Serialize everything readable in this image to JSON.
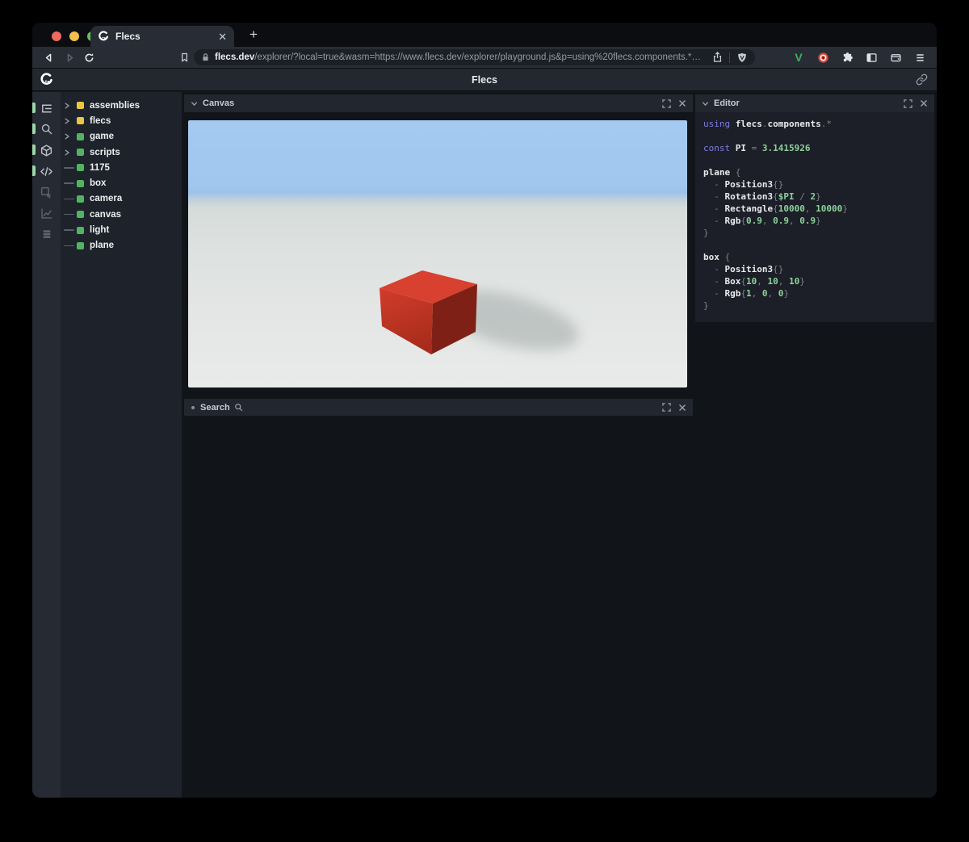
{
  "browser": {
    "traffic_lights": {
      "close": "#ec6a5e",
      "minimize": "#f4bf4f",
      "zoom": "#61c554"
    },
    "tab": {
      "title": "Flecs"
    },
    "new_tab_label": "+",
    "url_domain": "flecs.dev",
    "url_path": "/explorer/?local=true&wasm=https://www.flecs.dev/explorer/playground.js&p=using%20flecs.components.*%0A…"
  },
  "app_header": {
    "title": "Flecs"
  },
  "rail": {
    "items": [
      {
        "name": "tree",
        "active": true
      },
      {
        "name": "search",
        "active": true
      },
      {
        "name": "cube",
        "active": true
      },
      {
        "name": "code",
        "active": true
      },
      {
        "name": "inspect",
        "active": false
      },
      {
        "name": "chart",
        "active": false
      },
      {
        "name": "stack",
        "active": false
      }
    ]
  },
  "tree": {
    "items": [
      {
        "label": "assemblies",
        "color": "yellow",
        "expandable": true
      },
      {
        "label": "flecs",
        "color": "yellow",
        "expandable": true
      },
      {
        "label": "game",
        "color": "green",
        "expandable": true
      },
      {
        "label": "scripts",
        "color": "green",
        "expandable": true
      },
      {
        "label": "1175",
        "color": "green",
        "expandable": false
      },
      {
        "label": "box",
        "color": "green",
        "expandable": false
      },
      {
        "label": "camera",
        "color": "green",
        "expandable": false
      },
      {
        "label": "canvas",
        "color": "green",
        "expandable": false
      },
      {
        "label": "light",
        "color": "green",
        "expandable": false
      },
      {
        "label": "plane",
        "color": "green",
        "expandable": false
      }
    ]
  },
  "canvas_panel": {
    "title": "Canvas"
  },
  "search_panel": {
    "title": "Search"
  },
  "editor_panel": {
    "title": "Editor"
  },
  "code": {
    "lines": [
      [
        [
          "k",
          "using"
        ],
        [
          "p",
          " "
        ],
        [
          "i",
          "flecs"
        ],
        [
          "p",
          "."
        ],
        [
          "i",
          "components"
        ],
        [
          "p",
          ".*"
        ]
      ],
      [],
      [
        [
          "k",
          "const"
        ],
        [
          "p",
          " "
        ],
        [
          "i",
          "PI"
        ],
        [
          "p",
          " = "
        ],
        [
          "n",
          "3.1415926"
        ]
      ],
      [],
      [
        [
          "i",
          "plane"
        ],
        [
          "p",
          " {"
        ]
      ],
      [
        [
          "p",
          "  - "
        ],
        [
          "i",
          "Position3"
        ],
        [
          "p",
          "{}"
        ]
      ],
      [
        [
          "p",
          "  - "
        ],
        [
          "i",
          "Rotation3"
        ],
        [
          "p",
          "{"
        ],
        [
          "n",
          "$PI"
        ],
        [
          "p",
          " / "
        ],
        [
          "n",
          "2"
        ],
        [
          "p",
          "}"
        ]
      ],
      [
        [
          "p",
          "  - "
        ],
        [
          "i",
          "Rectangle"
        ],
        [
          "p",
          "{"
        ],
        [
          "n",
          "10000"
        ],
        [
          "p",
          ", "
        ],
        [
          "n",
          "10000"
        ],
        [
          "p",
          "}"
        ]
      ],
      [
        [
          "p",
          "  - "
        ],
        [
          "i",
          "Rgb"
        ],
        [
          "p",
          "{"
        ],
        [
          "n",
          "0.9"
        ],
        [
          "p",
          ", "
        ],
        [
          "n",
          "0.9"
        ],
        [
          "p",
          ", "
        ],
        [
          "n",
          "0.9"
        ],
        [
          "p",
          "}"
        ]
      ],
      [
        [
          "p",
          "}"
        ]
      ],
      [],
      [
        [
          "i",
          "box"
        ],
        [
          "p",
          " {"
        ]
      ],
      [
        [
          "p",
          "  - "
        ],
        [
          "i",
          "Position3"
        ],
        [
          "p",
          "{}"
        ]
      ],
      [
        [
          "p",
          "  - "
        ],
        [
          "i",
          "Box"
        ],
        [
          "p",
          "{"
        ],
        [
          "n",
          "10"
        ],
        [
          "p",
          ", "
        ],
        [
          "n",
          "10"
        ],
        [
          "p",
          ", "
        ],
        [
          "n",
          "10"
        ],
        [
          "p",
          "}"
        ]
      ],
      [
        [
          "p",
          "  - "
        ],
        [
          "i",
          "Rgb"
        ],
        [
          "p",
          "{"
        ],
        [
          "n",
          "1"
        ],
        [
          "p",
          ", "
        ],
        [
          "n",
          "0"
        ],
        [
          "p",
          ", "
        ],
        [
          "n",
          "0"
        ],
        [
          "p",
          "}"
        ]
      ],
      [
        [
          "p",
          "}"
        ]
      ]
    ]
  },
  "colors": {
    "yellow": "#e8c840",
    "green": "#52b462",
    "active_indicator": "#9ad7a9",
    "sky": "#a3c9f0",
    "ground": "#e3e6e5",
    "box_top": "#d8402f",
    "box_front_light": "#cf3b29",
    "box_front_dark": "#a82c1c",
    "box_side": "#7e2015",
    "keyword": "#7d7ae0",
    "identifier": "#e9ebee",
    "punctuation": "#798089",
    "number": "#8fd19c"
  }
}
